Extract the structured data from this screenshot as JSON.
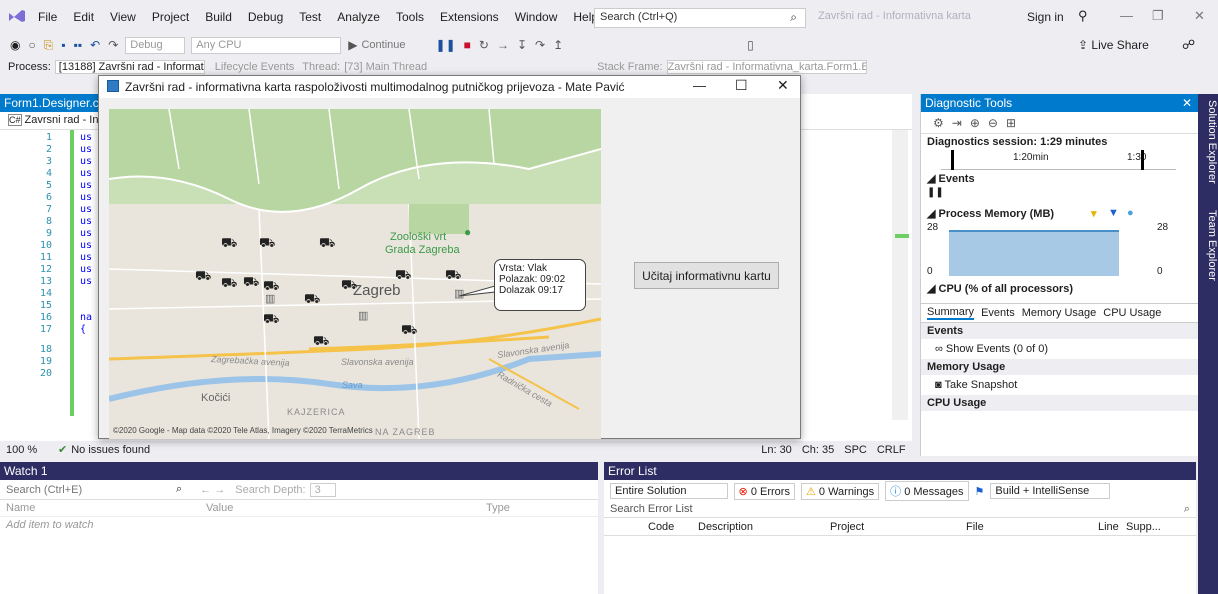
{
  "menu": [
    "File",
    "Edit",
    "View",
    "Project",
    "Build",
    "Debug",
    "Test",
    "Analyze",
    "Tools",
    "Extensions",
    "Window",
    "Help"
  ],
  "search_placeholder": "Search (Ctrl+Q)",
  "window_title": "Završni rad - Informativna karta",
  "sign_in": "Sign in",
  "toolbar": {
    "config": "Debug",
    "platform": "Any CPU",
    "continue": "Continue",
    "live_share": "Live Share"
  },
  "debugbar": {
    "process": "Process:",
    "process_value": "[13188] Završni rad - Informativna",
    "lifecycle": "Lifecycle Events",
    "thread": "Thread:",
    "thread_value": "[73] Main Thread",
    "stack": "Stack Frame:",
    "stack_value": "Završni rad - Informativna_karta.Form1.B"
  },
  "editor": {
    "tab": "Form1.Designer.cs",
    "scope": "Zavrsni rad - Inf",
    "lines": [
      "1",
      "2",
      "3",
      "4",
      "5",
      "6",
      "7",
      "8",
      "9",
      "10",
      "11",
      "12",
      "13",
      "14",
      "15",
      "16",
      "17",
      "18",
      "19",
      "20"
    ],
    "snippets": [
      "us",
      "us",
      "us",
      "us",
      "us",
      "us",
      "us",
      "us",
      "us",
      "us",
      "us",
      "us",
      "us",
      "",
      "",
      "na",
      "{",
      "",
      "",
      ""
    ],
    "zoom": "100 %",
    "issues": "No issues found",
    "ln": "Ln: 30",
    "ch": "Ch: 35",
    "spc": "SPC",
    "crlf": "CRLF"
  },
  "dialog": {
    "title": "Završni rad - informativna karta raspoloživosti multimodalnog putničkog prijevoza - Mate Pavić",
    "button": "Učitaj informativnu kartu",
    "callout": {
      "line1": "Vrsta: Vlak",
      "line2": "Polazak: 09:02",
      "line3": "Dolazak 09:17"
    },
    "map_labels": {
      "zoo": "Zoološki vrt",
      "zoo2": "Grada Zagreba",
      "city": "Zagreb",
      "av1": "Zagrebačka avenija",
      "av2": "Slavonska avenija",
      "av3": "Slavonska avenija",
      "sava": "Sava",
      "kocici": "Kočići",
      "kajzerica": "KAJZERICA",
      "radnicka": "Radnička cesta",
      "copyright": "©2020 Google - Map data ©2020 Tele Atlas, Imagery ©2020 TerraMetrics",
      "novi": "NA ZAGREB"
    }
  },
  "diag": {
    "title": "Diagnostic Tools",
    "session": "Diagnostics session: 1:29 minutes",
    "t1": "1:20min",
    "t2": "1:30",
    "events": "Events",
    "memory": "Process Memory (MB)",
    "mem_hi": "28",
    "mem_lo": "0",
    "cpu": "CPU (% of all processors)",
    "tabs": [
      "Summary",
      "Events",
      "Memory Usage",
      "CPU Usage"
    ],
    "s_events": "Events",
    "show_events": "Show Events (0 of 0)",
    "s_memory": "Memory Usage",
    "snapshot": "Take Snapshot",
    "s_cpu": "CPU Usage"
  },
  "watch": {
    "title": "Watch 1",
    "search": "Search (Ctrl+E)",
    "depth_label": "Search Depth:",
    "depth": "3",
    "cols": [
      "Name",
      "Value",
      "Type"
    ],
    "add": "Add item to watch"
  },
  "errors": {
    "title": "Error List",
    "scope": "Entire Solution",
    "err": "0 Errors",
    "warn": "0 Warnings",
    "msg": "0 Messages",
    "build": "Build + IntelliSense",
    "search": "Search Error List",
    "cols": [
      "Code",
      "Description",
      "Project",
      "File",
      "Line",
      "Supp..."
    ]
  },
  "side": {
    "a": "Solution Explorer",
    "b": "Team Explorer"
  }
}
